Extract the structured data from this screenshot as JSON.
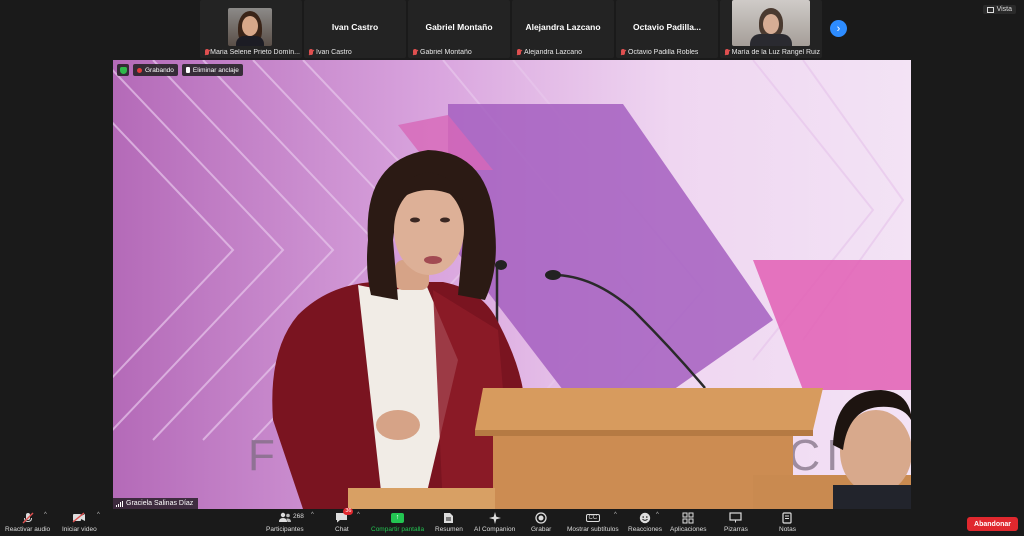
{
  "participants_strip": [
    {
      "display": "",
      "label": "Maria Selene Prieto Domín...",
      "has_photo": true
    },
    {
      "display": "Ivan Castro",
      "label": "Ivan Castro",
      "has_photo": false
    },
    {
      "display": "Gabriel Montaño",
      "label": "Gabriel Montaño",
      "has_photo": false
    },
    {
      "display": "Alejandra Lazcano",
      "label": "Alejandra Lazcano",
      "has_photo": false
    },
    {
      "display": "Octavio  Padilla...",
      "label": "Octavio Padilla Robles",
      "has_photo": false
    },
    {
      "display": "",
      "label": "María de la Luz Rangel Ruiz",
      "has_photo": true
    }
  ],
  "view_button": "Vista",
  "badges": {
    "recording": "Grabando",
    "unpin": "Eliminar anclaje"
  },
  "main_video": {
    "speaker": "Graciela Salinas Díaz",
    "background_text": "F         ACI"
  },
  "toolbar": {
    "audio": "Reactivar audio",
    "video": "Iniciar video",
    "participants": "Participantes",
    "participants_count": "268",
    "chat": "Chat",
    "chat_badge": "36",
    "share": "Compartir pantalla",
    "summary": "Resumen",
    "companion": "AI Companion",
    "record": "Grabar",
    "captions": "Mostrar subtítulos",
    "captions_icon": "CC",
    "reactions": "Reacciones",
    "apps": "Aplicaciones",
    "whiteboards": "Pizarras",
    "notes": "Notas",
    "leave": "Abandonar"
  },
  "colors": {
    "accent_blue": "#2d8cff",
    "share_green": "#23c552",
    "leave_red": "#e0282e",
    "muted_red": "#e05050"
  }
}
